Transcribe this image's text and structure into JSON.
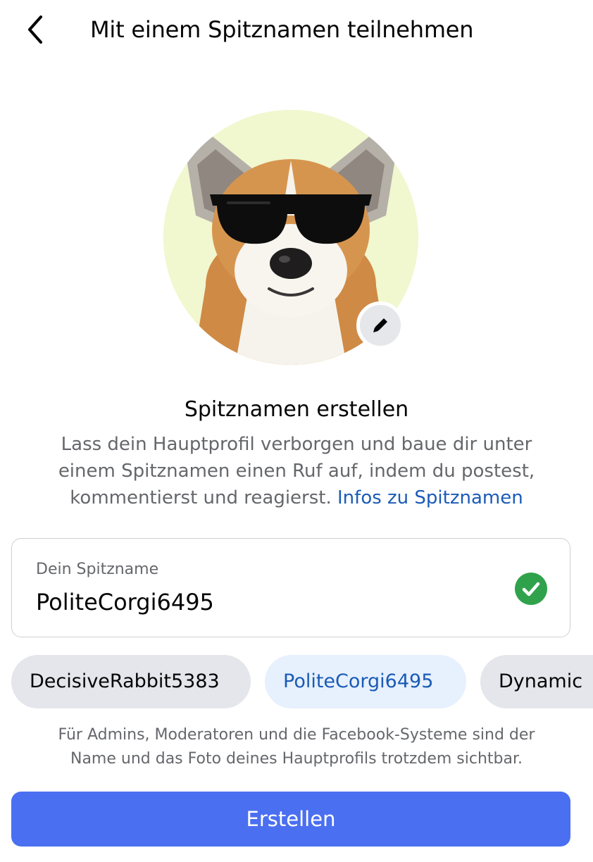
{
  "header": {
    "title": "Mit einem Spitznamen teilnehmen",
    "back_icon": "chevron-left-icon"
  },
  "avatar": {
    "subject": "corgi-with-sunglasses",
    "background_color": "#f1f7cf",
    "edit_icon": "pencil-icon"
  },
  "section": {
    "title": "Spitznamen erstellen",
    "description_line1": "Lass dein Hauptprofil verborgen und baue dir unter",
    "description_line2": "einem Spitznamen einen Ruf auf, indem du postest,",
    "description_line3": "kommentierst und reagierst.",
    "info_link": "Infos zu Spitznamen"
  },
  "nickname_field": {
    "label": "Dein Spitzname",
    "value": "PoliteCorgi6495",
    "status_icon": "check-circle-icon"
  },
  "suggestions": [
    {
      "label": "DecisiveRabbit5383",
      "selected": false
    },
    {
      "label": "PoliteCorgi6495",
      "selected": true
    },
    {
      "label": "Dynamic",
      "selected": false
    }
  ],
  "footnote": {
    "line1": "Für Admins, Moderatoren und die Facebook-Systeme sind der",
    "line2": "Name und das Foto deines Hauptprofils trotzdem sichtbar."
  },
  "create_button": {
    "label": "Erstellen",
    "color": "#4a6ff0"
  }
}
